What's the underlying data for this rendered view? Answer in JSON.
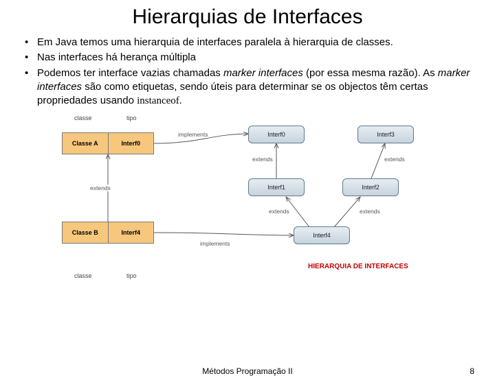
{
  "title": "Hierarquias de Interfaces",
  "bullets": {
    "b1": "Em Java temos uma hierarquia de interfaces paralela à hierarquia de classes.",
    "b2": "Nas interfaces há herança múltipla",
    "b3a": "Podemos ter interface vazias chamadas ",
    "b3b": "marker interfaces",
    "b3c": " (por essa mesma razão). As ",
    "b3d": "marker interfaces",
    "b3e": " são como etiquetas, sendo úteis para determinar se os objectos têm certas propriedades usando ",
    "b3f": "instanceof."
  },
  "diagram": {
    "col_top": {
      "classe": "classe",
      "tipo": "tipo"
    },
    "classA": {
      "c1": "Classe A",
      "c2": "Interf0"
    },
    "classB": {
      "c1": "Classe B",
      "c2": "Interf4"
    },
    "col_bottom": {
      "classe": "classe",
      "tipo": "tipo"
    },
    "nodes": {
      "i0": "Interf0",
      "i1": "Interf1",
      "i2": "Interf2",
      "i3": "Interf3",
      "i4": "Interf4"
    },
    "edges": {
      "extends_left": "extends",
      "implements_i0": "implements",
      "implements_i4": "implements",
      "extends_i0_i1": "extends",
      "extends_i3_i2": "extends",
      "extends_i1_i4": "extends",
      "extends_i2_i4": "extends"
    },
    "red": "HIERARQUIA DE INTERFACES"
  },
  "footer": {
    "center": "Métodos Programação II",
    "num": "8"
  }
}
